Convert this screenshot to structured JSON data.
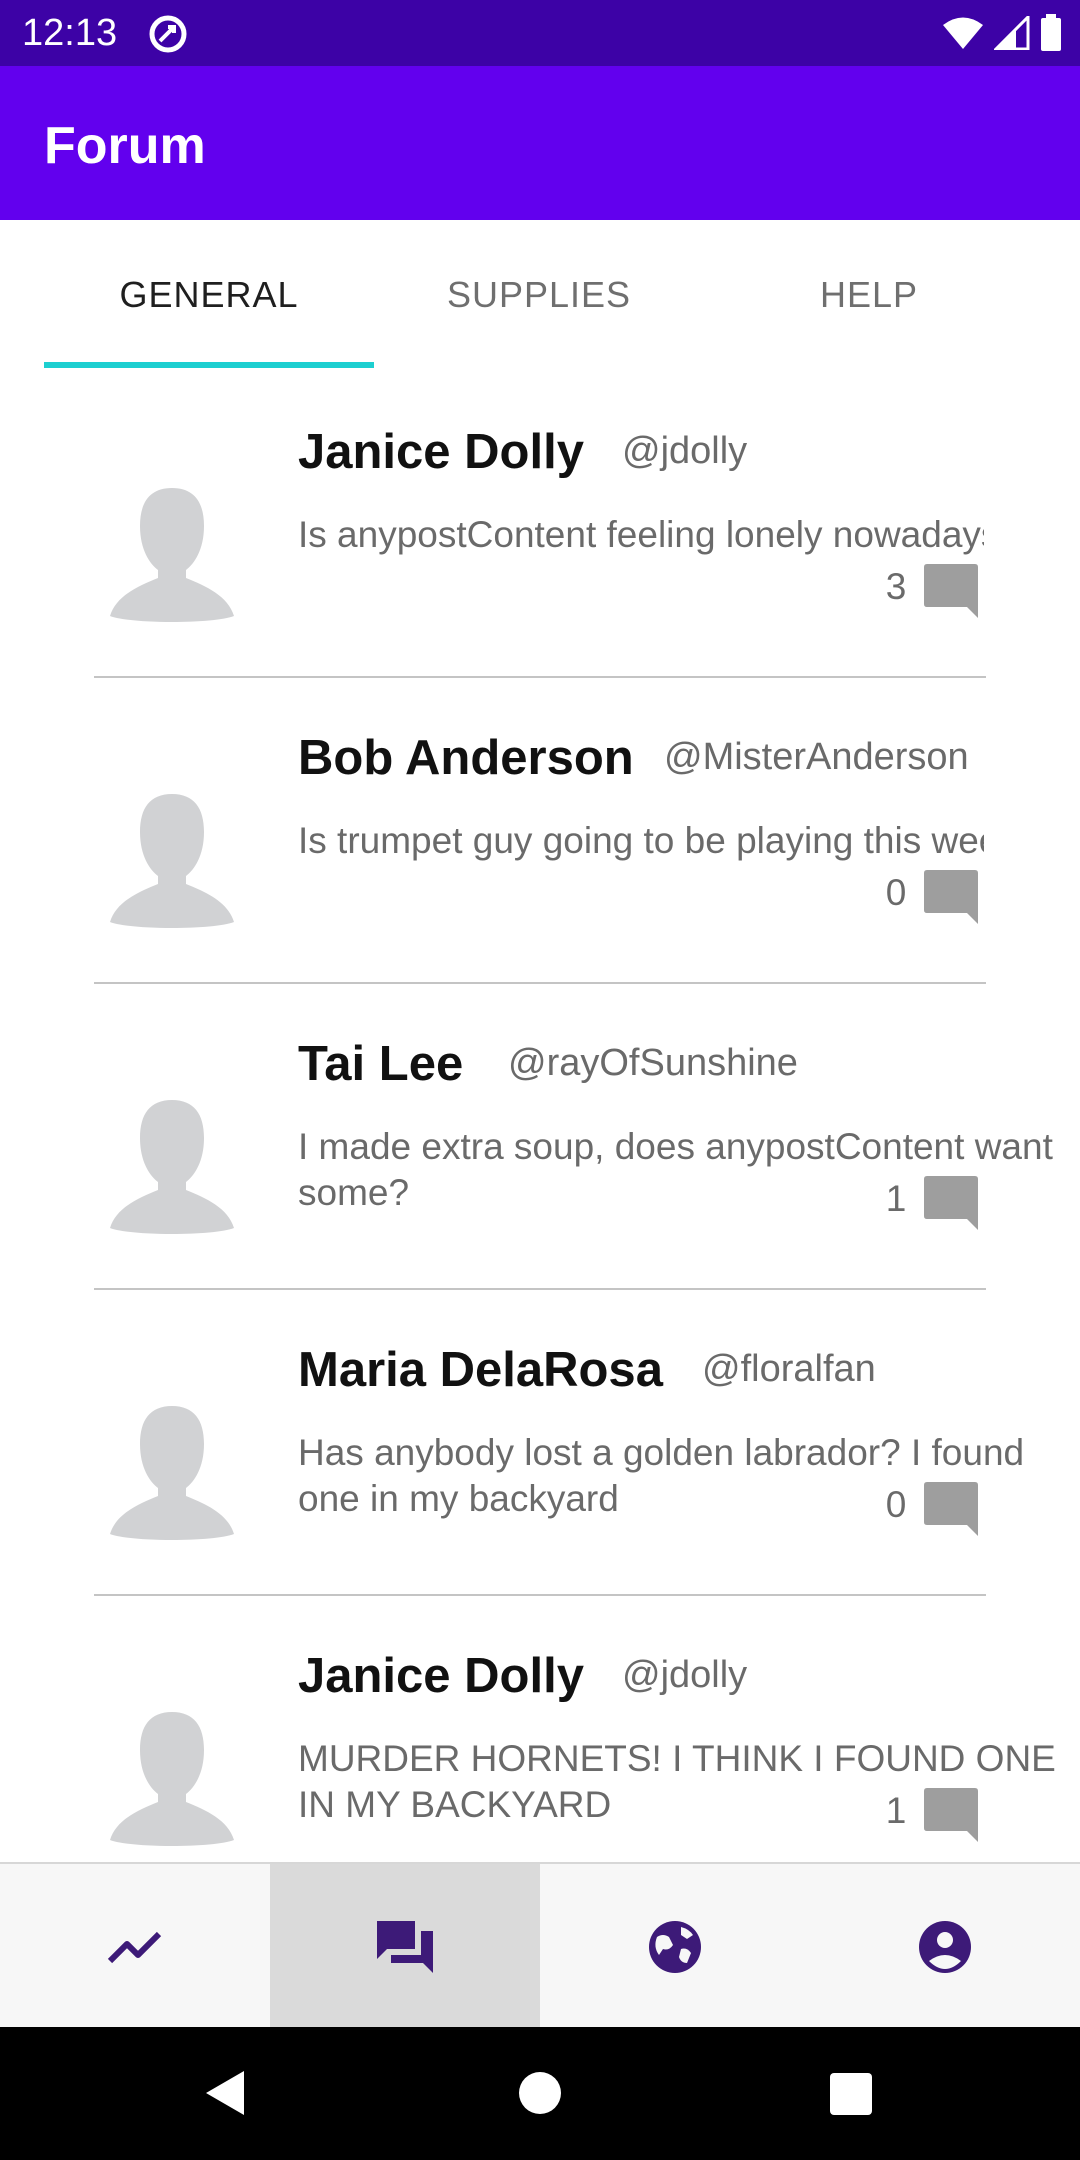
{
  "status_bar": {
    "time": "12:13"
  },
  "app_bar": {
    "title": "Forum"
  },
  "tabs": [
    {
      "label": "GENERAL",
      "active": true
    },
    {
      "label": "SUPPLIES",
      "active": false
    },
    {
      "label": "HELP",
      "active": false
    }
  ],
  "posts": [
    {
      "author": "Janice Dolly",
      "handle": "@jdolly",
      "text": "Is anypostContent feeling lonely nowadays?",
      "replies": "3"
    },
    {
      "author": "Bob Anderson",
      "handle": "@MisterAnderson",
      "text": "Is trumpet guy going to be playing this week?",
      "replies": "0"
    },
    {
      "author": "Tai Lee",
      "handle": "@rayOfSunshine",
      "text": "I made extra soup, does anypostContent want some?",
      "replies": "1"
    },
    {
      "author": "Maria DelaRosa",
      "handle": "@floralfan",
      "text": "Has anybody lost a golden labrador? I found one in my backyard",
      "replies": "0"
    },
    {
      "author": "Janice Dolly",
      "handle": "@jdolly",
      "text": "MURDER HORNETS! I THINK I FOUND ONE IN MY BACKYARD",
      "replies": "1"
    }
  ],
  "bottom_nav": [
    {
      "icon": "trending-icon",
      "selected": false
    },
    {
      "icon": "forum-icon",
      "selected": true
    },
    {
      "icon": "globe-icon",
      "selected": false
    },
    {
      "icon": "account-icon",
      "selected": false
    }
  ],
  "colors": {
    "status_bar": "#3D02A6",
    "app_bar": "#6200EE",
    "tab_indicator": "#1DCFD0",
    "nav_icon": "#3D1A78"
  }
}
